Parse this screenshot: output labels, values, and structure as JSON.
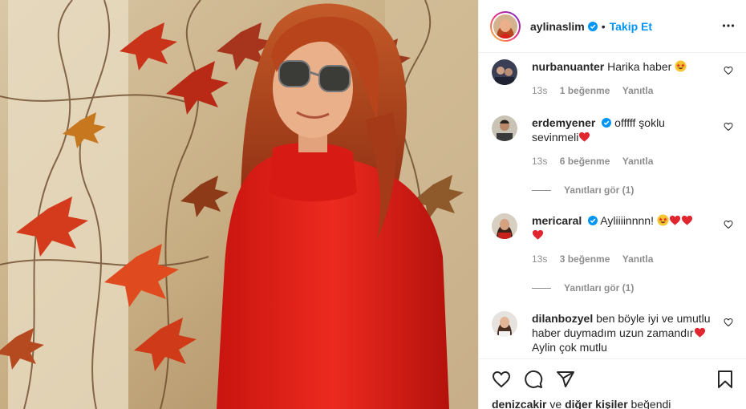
{
  "post": {
    "username": "aylinaslim",
    "follow_label": "Takip Et",
    "separator": "•"
  },
  "comments": [
    {
      "username": "nurbanuanter",
      "verified": false,
      "text": "Harika haber",
      "emojis": [
        "star-struck"
      ],
      "time": "13s",
      "likes": "1 beğenme",
      "reply": "Yanıtla"
    },
    {
      "username": "erdemyener",
      "verified": true,
      "text": "offfff şoklu sevinmeli",
      "emojis": [
        "red-heart"
      ],
      "time": "13s",
      "likes": "6 beğenme",
      "reply": "Yanıtla",
      "view_replies": "Yanıtları gör (1)"
    },
    {
      "username": "mericaral",
      "verified": true,
      "text": "Ayliiiinnnn!",
      "emojis": [
        "star-struck",
        "red-heart",
        "red-heart",
        "red-heart"
      ],
      "time": "13s",
      "likes": "3 beğenme",
      "reply": "Yanıtla",
      "view_replies": "Yanıtları gör (1)"
    },
    {
      "username": "dilanbozyel",
      "verified": false,
      "text_part1": "ben böyle iyi ve umutlu haber duymadım uzun zamandır",
      "text_part2": "Aylin çok mutlu",
      "emojis": [
        "red-heart"
      ]
    }
  ],
  "liked_by": {
    "user": "denizcakir",
    "connector": "ve",
    "others": "diğer kişiler",
    "suffix": "beğendi"
  },
  "colors": {
    "accent": "#0095f6",
    "heart": "#ed4956",
    "secondary_text": "#8e8e8e",
    "sweater": "#e0201b",
    "hair": "#b8441c"
  },
  "icons": [
    "verified-badge-icon",
    "more-options-icon",
    "heart-icon",
    "comment-icon",
    "share-icon",
    "save-icon"
  ]
}
